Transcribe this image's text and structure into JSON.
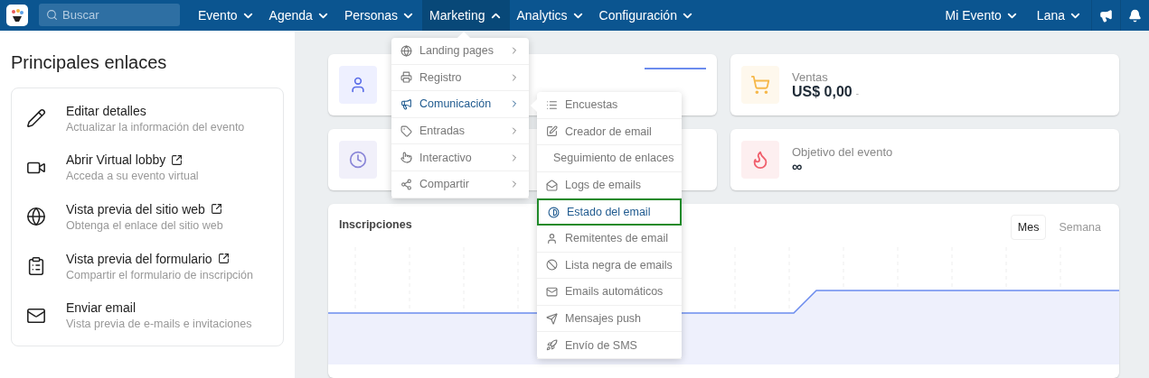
{
  "navbar": {
    "search": {
      "placeholder": "Buscar"
    },
    "menus": [
      {
        "label": "Evento",
        "selected": false,
        "expanded": false
      },
      {
        "label": "Agenda",
        "selected": false,
        "expanded": false
      },
      {
        "label": "Personas",
        "selected": false,
        "expanded": false
      },
      {
        "label": "Marketing",
        "selected": true,
        "expanded": true
      },
      {
        "label": "Analytics",
        "selected": false,
        "expanded": false
      },
      {
        "label": "Configuración",
        "selected": false,
        "expanded": false
      }
    ],
    "right_menus": [
      {
        "label": "Mi Evento"
      },
      {
        "label": "Lana"
      }
    ]
  },
  "sidebar": {
    "title": "Principales enlaces",
    "links": [
      {
        "title": "Editar detalles",
        "subtitle": "Actualizar la información del evento",
        "external": false
      },
      {
        "title": "Abrir Virtual lobby",
        "subtitle": "Acceda a su evento virtual",
        "external": true
      },
      {
        "title": "Vista previa del sitio web",
        "subtitle": "Obtenga el enlace del sitio web",
        "external": true
      },
      {
        "title": "Vista previa del formulario",
        "subtitle": "Compartir el formulario de inscripción",
        "external": true
      },
      {
        "title": "Enviar email",
        "subtitle": "Vista previa de e-mails e invitaciones",
        "external": false
      }
    ]
  },
  "stats": [
    {
      "label": "Ventas",
      "value": "US$ 0,00",
      "note": "-",
      "color": "#f6b84a"
    },
    {
      "label": "Objetivo del evento",
      "value": "∞",
      "color": "#f0606d"
    }
  ],
  "chart_card": {
    "title": "Inscripciones",
    "tabs": [
      {
        "label": "Mes",
        "selected": true
      },
      {
        "label": "Semana",
        "selected": false
      }
    ]
  },
  "marketing_menu": [
    {
      "label": "Landing pages",
      "selected": false
    },
    {
      "label": "Registro",
      "selected": false
    },
    {
      "label": "Comunicación",
      "selected": true
    },
    {
      "label": "Entradas",
      "selected": false
    },
    {
      "label": "Interactivo",
      "selected": false
    },
    {
      "label": "Compartir",
      "selected": false
    }
  ],
  "communication_submenu": [
    {
      "label": "Encuestas",
      "selected": false
    },
    {
      "label": "Creador de email",
      "selected": false
    },
    {
      "label": "Seguimiento de enlaces",
      "selected": false
    },
    {
      "label": "Logs de emails",
      "selected": false
    },
    {
      "label": "Estado del email",
      "selected": true
    },
    {
      "label": "Remitentes de email",
      "selected": false
    },
    {
      "label": "Lista negra de emails",
      "selected": false
    },
    {
      "label": "Emails automáticos",
      "selected": false
    },
    {
      "label": "Mensajes push",
      "selected": false
    },
    {
      "label": "Envío de SMS",
      "selected": false
    }
  ]
}
